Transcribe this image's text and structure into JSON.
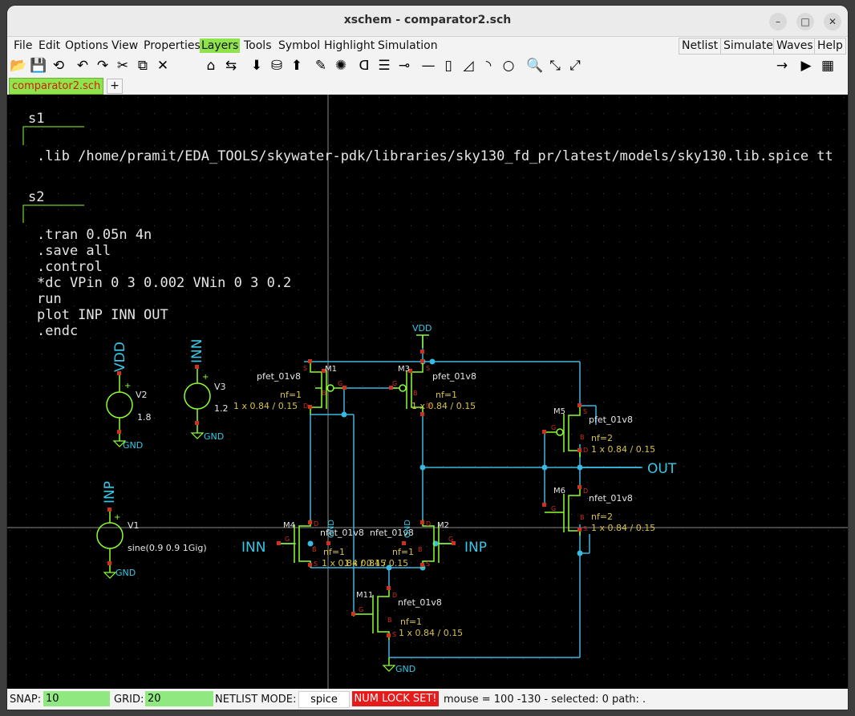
{
  "window": {
    "title": "xschem - comparator2.sch",
    "minimize_glyph": "–",
    "maximize_glyph": "□",
    "close_glyph": "✕"
  },
  "menubar": {
    "items": [
      "File",
      "Edit",
      "Options",
      "View",
      "Properties",
      "Layers",
      "Tools",
      "Symbol",
      "Highlight",
      "Simulation"
    ],
    "active_item": "Layers",
    "right_buttons": [
      "Netlist",
      "Simulate",
      "Waves",
      "Help"
    ]
  },
  "toolbar": {
    "icons": [
      "open-icon",
      "save-icon",
      "reload-icon",
      "undo-icon",
      "redo-icon",
      "cut-icon",
      "copy-icon",
      "delete-icon",
      "insert-symbol-icon",
      "move-icon",
      "push-down-icon",
      "make-symbol-icon",
      "pop-up-icon",
      "draw-wire-icon",
      "highlight-icon",
      "insert-gate-icon",
      "insert-text-icon",
      "insert-pin-icon",
      "line-icon",
      "rect-icon",
      "polygon-icon",
      "arc-icon",
      "circle-icon",
      "zoom-icon",
      "zoom-in-icon",
      "zoom-out-icon",
      "netlist-icon",
      "run-icon",
      "waves-icon"
    ],
    "glyphs": [
      "📂",
      "💾",
      "⟲",
      "↶",
      "↷",
      "✂",
      "⧉",
      "✕",
      "⌂",
      "⇆",
      "⬇",
      "⛁",
      "⬆",
      "✎",
      "✺",
      "ᗡ",
      "☰",
      "⊸",
      "—",
      "▯",
      "◿",
      "◝",
      "○",
      "🔍",
      "⤡",
      "⤢",
      "→",
      "▶",
      "▦"
    ]
  },
  "tabs": {
    "active": "comparator2.sch",
    "add_label": "+"
  },
  "colors": {
    "canvas_bg": "#000000",
    "wire": "#3ab8e0",
    "component": "#8cff2e",
    "pin_red": "#d03020",
    "text_white": "#e6e6e6",
    "text_yellow": "#d6c24a",
    "net_label": "#36c8e8",
    "menu_active": "#8fe34d",
    "status_field": "#8fe880",
    "numlock_bg": "#e51b1b"
  },
  "code_blocks": [
    {
      "name": "s1",
      "lines": [
        ".lib /home/pramit/EDA_TOOLS/skywater-pdk/libraries/sky130_fd_pr/latest/models/sky130.lib.spice tt"
      ]
    },
    {
      "name": "s2",
      "lines": [
        ".tran 0.05n 4n",
        ".save all",
        ".control",
        "*dc VPin 0 3 0.002 VNin 0 3 0.2",
        "run",
        "plot INP INN OUT",
        ".endc"
      ]
    }
  ],
  "sources": [
    {
      "ref": "V2",
      "value": "1.8",
      "net": "VDD",
      "gnd": "GND"
    },
    {
      "ref": "V3",
      "value": "1.2",
      "net": "INN",
      "gnd": "GND"
    },
    {
      "ref": "V1",
      "value": "sine(0.9 0.9 1Gig)",
      "net": "INP",
      "gnd": "GND"
    }
  ],
  "transistors": [
    {
      "ref": "M1",
      "model": "pfet_01v8",
      "nf": "nf=1",
      "size": "1 x 0.84 / 0.15"
    },
    {
      "ref": "M3",
      "model": "pfet_01v8",
      "nf": "nf=1",
      "size": "1 x 0.84 / 0.15"
    },
    {
      "ref": "M5",
      "model": "pfet_01v8",
      "nf": "nf=2",
      "size": "1 x 0.84 / 0.15"
    },
    {
      "ref": "M6",
      "model": "nfet_01v8",
      "nf": "nf=2",
      "size": "1 x 0.84 / 0.15"
    },
    {
      "ref": "M4",
      "model": "nfet_01v8",
      "nf": "nf=1",
      "size": "1 x 0.84 / 0.15"
    },
    {
      "ref": "M2",
      "model": "nfet_01v8",
      "nf": "nf=1",
      "size": "1 x 0.84 / 0.15"
    },
    {
      "ref": "M11",
      "model": "nfet_01v8",
      "nf": "nf=1",
      "size": "1 x 0.84 / 0.15"
    }
  ],
  "pin_letters": {
    "drain": "D",
    "gate": "G",
    "source": "S",
    "bulk": "B"
  },
  "net_labels": {
    "vdd": "VDD",
    "out": "OUT",
    "inn": "INN",
    "inp": "INP",
    "gnd": "GND",
    "m4_bulk": "GND",
    "m2_bulk": "GND"
  },
  "status": {
    "snap_label": "SNAP:",
    "snap_value": "10",
    "grid_label": "GRID:",
    "grid_value": "20",
    "netlist_mode_label": "NETLIST MODE:",
    "netlist_mode_value": "spice",
    "numlock": "NUM LOCK SET!",
    "mouse_info": "mouse = 100 -130 - selected: 0 path: ."
  }
}
